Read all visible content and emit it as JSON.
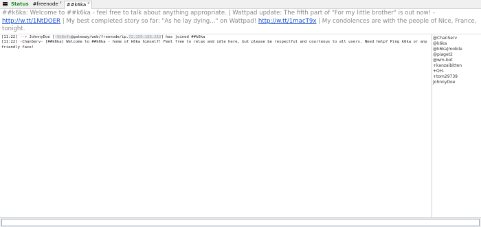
{
  "tabs": [
    {
      "label": "Status",
      "closable": false
    },
    {
      "label": "#freenode",
      "closable": true
    },
    {
      "label": "##k6ka",
      "closable": true,
      "active": true
    }
  ],
  "topic": {
    "part1": "##k6ka: Welcome to ##k6ka - feel free to talk about anything appropriate. | Wattpad update: The fifth part of \"For my little brother\" is out now! -",
    "link1": "http://w.tt/1NtDOER",
    "part2": " | My best completed story so far: \"As he lay dying...\" on Wattpad! ",
    "link2": "http://w.tt/1macT9x",
    "part3": " | My condolences are with the people of Nice, France, tonight."
  },
  "messages": [
    {
      "time": "[11:22]",
      "arrow": "-->",
      "nick": "JohnnyDoe",
      "host_prefix": "[",
      "host_blurred": "~9b8e4c",
      "host_mid": "@gateway/web/freenode/ip.",
      "host_ip_blurred": "72.150.185.213",
      "host_suffix": "] has joined ##k6ka"
    },
    {
      "time": "[11:22]",
      "text": "-ChanServ- [##k6ka] Welcome to ##k6ka - home of k6ka himself! Feel free to relax and idle here, but please be respectful and courteous to all users. Need help? Ping k6ka or any friendly face!"
    }
  ],
  "nicks": [
    "@ChanServ",
    "@k6ka",
    "@k6ka|mobile",
    "@piaget2",
    "@wm-bot",
    "+kanzaibitten",
    "+OH-",
    "+tom29739",
    "JohnnyDoe"
  ],
  "colors": {
    "status_tab": "#1a8a1a",
    "link": "#1a4fd1",
    "topic_text": "#888888",
    "join_arrow": "#c0392b"
  }
}
